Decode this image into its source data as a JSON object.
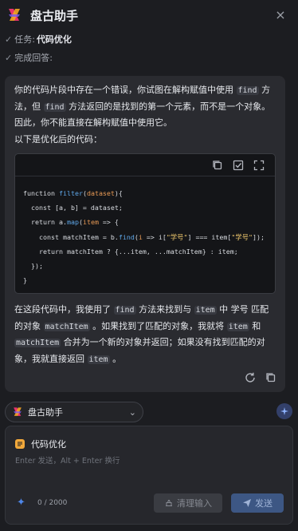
{
  "header": {
    "title": "盘古助手",
    "close_label": "×"
  },
  "task": {
    "label": "任务:",
    "value": "代码优化"
  },
  "status": {
    "label": "完成回答:"
  },
  "answer": {
    "intro": [
      {
        "t": "你的代码片段中存在一个错误，你试图在解构赋值中使用 "
      },
      {
        "c": "find"
      },
      {
        "t": " 方法，但 "
      },
      {
        "c": "find"
      },
      {
        "t": " 方法返回的是找到的第一个元素，而不是一个对象。因此，你不能直接在解构赋值中使用它。"
      }
    ],
    "subtitle": "以下是优化后的代码：",
    "code_lines": [
      "function filter(dataset){",
      "  const [a, b] = dataset;",
      "  return a.map(item => {",
      "    const matchItem = b.find(i => i[\"学号\"] === item[\"学号\"]);",
      "    return matchItem ? {...item, ...matchItem} : item;",
      "  });",
      "}"
    ],
    "outro": [
      {
        "t": "在这段代码中，我使用了 "
      },
      {
        "c": "find"
      },
      {
        "t": " 方法来找到与 "
      },
      {
        "c": "item"
      },
      {
        "t": " 中 学号 匹配的对象 "
      },
      {
        "c": "matchItem"
      },
      {
        "t": " 。如果找到了匹配的对象，我就将 "
      },
      {
        "c": "item"
      },
      {
        "t": " 和 "
      },
      {
        "c": "matchItem"
      },
      {
        "t": " 合并为一个新的对象并返回；如果没有找到匹配的对象，我就直接返回 "
      },
      {
        "c": "item"
      },
      {
        "t": " 。"
      }
    ]
  },
  "assistant_select": {
    "label": "盘古助手"
  },
  "input": {
    "topic": "代码优化",
    "placeholder": "Enter 发送，Alt + Enter 换行",
    "value": "",
    "count": "0 / 2000",
    "clear_label": "清理输入",
    "send_label": "发送"
  },
  "colors": {
    "background": "#1c1d21",
    "card": "#2a2b30",
    "accent": "#3d5784",
    "topic_icon": "#f2a93b"
  }
}
